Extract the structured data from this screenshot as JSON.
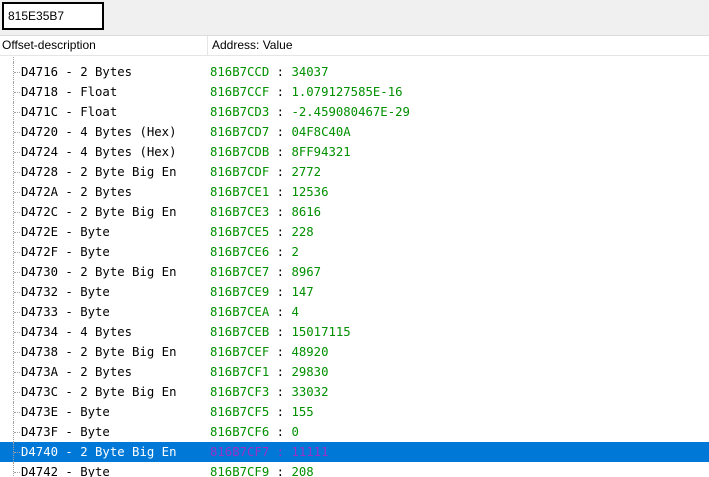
{
  "address_input": {
    "value": "815E35B7"
  },
  "columns": {
    "description": "Offset-description",
    "value": "Address: Value"
  },
  "rows": [
    {
      "desc": "D4716 - 2 Bytes",
      "addr": "816B7CCD",
      "value": "34037"
    },
    {
      "desc": "D4718 - Float",
      "addr": "816B7CCF",
      "value": "1.079127585E-16"
    },
    {
      "desc": "D471C - Float",
      "addr": "816B7CD3",
      "value": "-2.459080467E-29"
    },
    {
      "desc": "D4720 - 4 Bytes (Hex)",
      "addr": "816B7CD7",
      "value": "04F8C40A"
    },
    {
      "desc": "D4724 - 4 Bytes (Hex)",
      "addr": "816B7CDB",
      "value": "8FF94321"
    },
    {
      "desc": "D4728 - 2 Byte Big En",
      "addr": "816B7CDF",
      "value": "2772"
    },
    {
      "desc": "D472A - 2 Bytes",
      "addr": "816B7CE1",
      "value": "12536"
    },
    {
      "desc": "D472C - 2 Byte Big En",
      "addr": "816B7CE3",
      "value": "8616"
    },
    {
      "desc": "D472E - Byte",
      "addr": "816B7CE5",
      "value": "228"
    },
    {
      "desc": "D472F - Byte",
      "addr": "816B7CE6",
      "value": "2"
    },
    {
      "desc": "D4730 - 2 Byte Big En",
      "addr": "816B7CE7",
      "value": "8967"
    },
    {
      "desc": "D4732 - Byte",
      "addr": "816B7CE9",
      "value": "147"
    },
    {
      "desc": "D4733 - Byte",
      "addr": "816B7CEA",
      "value": "4"
    },
    {
      "desc": "D4734 - 4 Bytes",
      "addr": "816B7CEB",
      "value": "15017115"
    },
    {
      "desc": "D4738 - 2 Byte Big En",
      "addr": "816B7CEF",
      "value": "48920"
    },
    {
      "desc": "D473A - 2 Bytes",
      "addr": "816B7CF1",
      "value": "29830"
    },
    {
      "desc": "D473C - 2 Byte Big En",
      "addr": "816B7CF3",
      "value": "33032"
    },
    {
      "desc": "D473E - Byte",
      "addr": "816B7CF5",
      "value": "155"
    },
    {
      "desc": "D473F - Byte",
      "addr": "816B7CF6",
      "value": "0"
    },
    {
      "desc": "D4740 - 2 Byte Big En",
      "addr": "816B7CF7",
      "value": "11111",
      "selected": true
    },
    {
      "desc": "D4742 - Byte",
      "addr": "816B7CF9",
      "value": "208"
    }
  ],
  "separator": ":",
  "colors": {
    "address": "#009000",
    "selection": "#0078d7",
    "selected_text": "#9b30c8"
  }
}
